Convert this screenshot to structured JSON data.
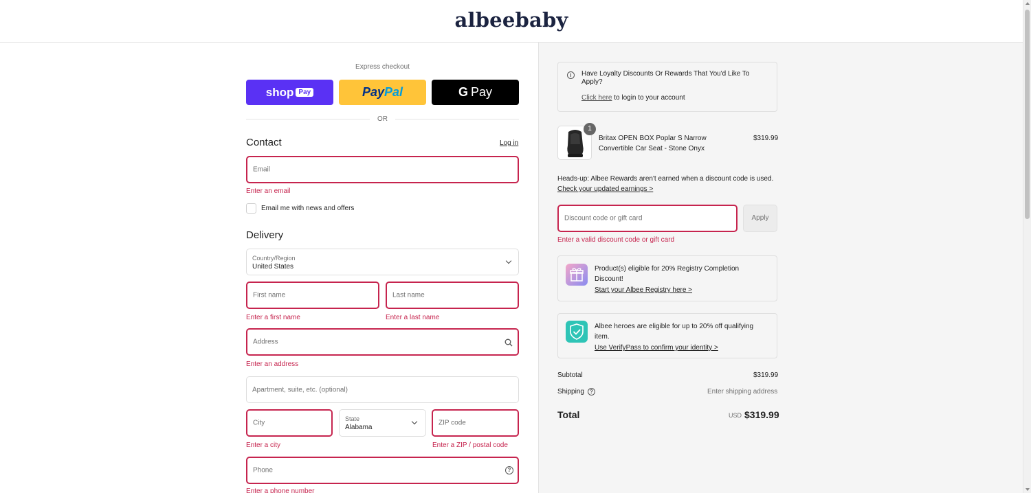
{
  "brand": {
    "logo_text": "albeebaby"
  },
  "express": {
    "label": "Express checkout",
    "shop_pay": {
      "text": "shop",
      "chip": "Pay"
    },
    "paypal": {
      "part1": "Pay",
      "part2": "Pal"
    },
    "gpay": {
      "g": "G",
      "text": "Pay"
    },
    "or_text": "OR"
  },
  "contact": {
    "title": "Contact",
    "login_link": "Log in",
    "email_placeholder": "Email",
    "email_error": "Enter an email",
    "newsletter_label": "Email me with news and offers"
  },
  "delivery": {
    "title": "Delivery",
    "country_label": "Country/Region",
    "country_value": "United States",
    "first_name_placeholder": "First name",
    "first_name_error": "Enter a first name",
    "last_name_placeholder": "Last name",
    "last_name_error": "Enter a last name",
    "address_placeholder": "Address",
    "address_error": "Enter an address",
    "apartment_placeholder": "Apartment, suite, etc. (optional)",
    "city_placeholder": "City",
    "city_error": "Enter a city",
    "state_label": "State",
    "state_value": "Alabama",
    "zip_placeholder": "ZIP code",
    "zip_error": "Enter a ZIP / postal code",
    "phone_placeholder": "Phone",
    "phone_error": "Enter a phone number"
  },
  "summary": {
    "loyalty": {
      "title": "Have Loyalty Discounts Or Rewards That You'd Like To Apply?",
      "link": "Click here",
      "link_suffix": "to login to your account"
    },
    "item": {
      "quantity": "1",
      "name": "Britax OPEN BOX Poplar S Narrow Convertible Car Seat - Stone Onyx",
      "price": "$319.99"
    },
    "heads_up": {
      "text": "Heads-up: Albee Rewards aren't earned when a discount code is used.",
      "link": "Check your updated earnings >"
    },
    "discount": {
      "placeholder": "Discount code or gift card",
      "apply": "Apply",
      "error": "Enter a valid discount code or gift card"
    },
    "registry": {
      "text": "Product(s) eligible for 20% Registry Completion Discount!",
      "link": "Start your Albee Registry here >"
    },
    "heroes": {
      "text": "Albee heroes are eligible for up to 20% off qualifying item.",
      "link": "Use VerifyPass to confirm your identity >"
    },
    "subtotal_label": "Subtotal",
    "subtotal_value": "$319.99",
    "shipping_label": "Shipping",
    "shipping_value": "Enter shipping address",
    "total_label": "Total",
    "total_currency": "USD",
    "total_value": "$319.99"
  },
  "colors": {
    "error": "#c6244e",
    "shop_pay": "#5a31f4",
    "paypal": "#ffc439",
    "gpay": "#000000",
    "logo": "#1b2340"
  },
  "icons": [
    "info-icon",
    "search-icon",
    "help-circle-icon",
    "chevron-down-icon",
    "gift-icon",
    "shield-check-icon"
  ]
}
